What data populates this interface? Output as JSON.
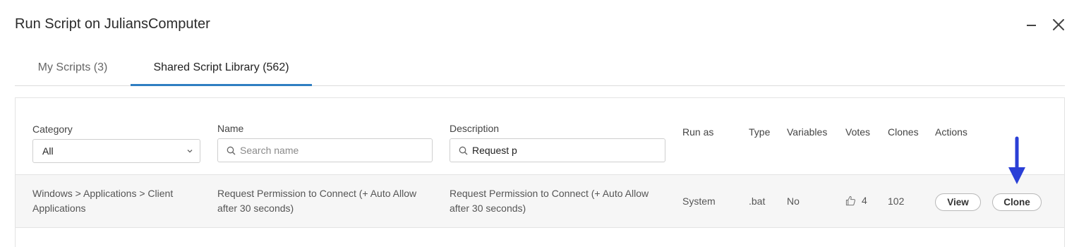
{
  "window": {
    "title": "Run Script on JuliansComputer",
    "minimize_icon": "minimize-icon",
    "close_icon": "close-icon"
  },
  "tabs": [
    {
      "label": "My Scripts (3)",
      "active": false
    },
    {
      "label": "Shared Script Library (562)",
      "active": true
    }
  ],
  "columns": {
    "category": "Category",
    "name": "Name",
    "description": "Description",
    "run_as": "Run as",
    "type": "Type",
    "variables": "Variables",
    "votes": "Votes",
    "clones": "Clones",
    "actions": "Actions"
  },
  "filters": {
    "category_value": "All",
    "name_placeholder": "Search name",
    "name_value": "",
    "description_value": "Request p"
  },
  "rows": [
    {
      "category": "Windows > Applications > Client Applications",
      "name": "Request Permission to Connect (+ Auto Allow after 30 seconds)",
      "description": "Request Permission to Connect (+ Auto Allow after 30 seconds)",
      "run_as": "System",
      "type": ".bat",
      "variables": "No",
      "votes": "4",
      "clones": "102",
      "view_label": "View",
      "clone_label": "Clone"
    }
  ],
  "colors": {
    "active_tab_underline": "#2f7ec2",
    "annotation_arrow": "#2a3fd6"
  }
}
